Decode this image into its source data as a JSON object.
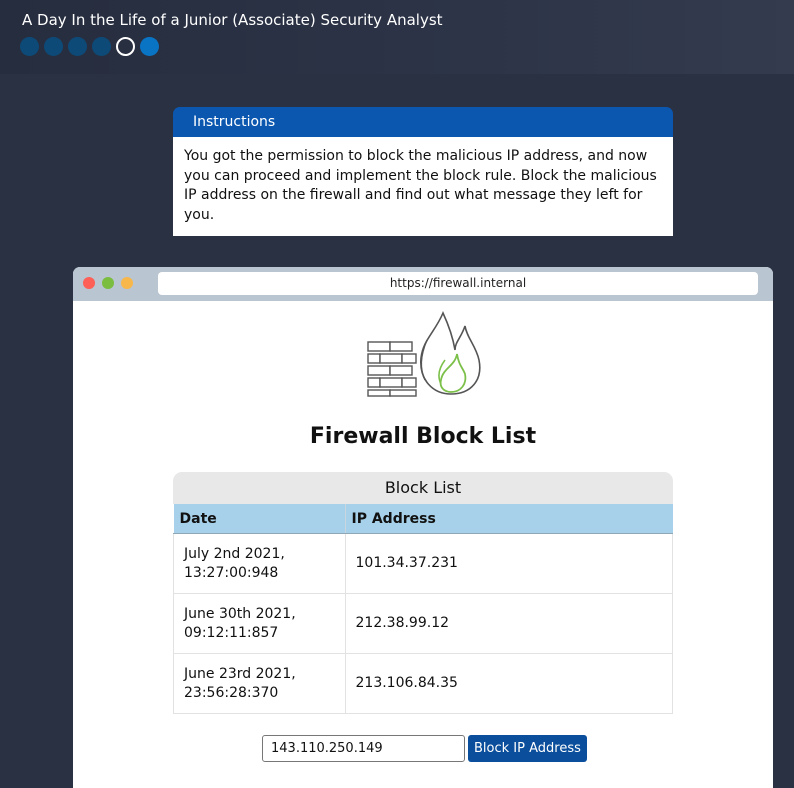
{
  "header": {
    "title": "A Day In the Life of a Junior (Associate) Security Analyst",
    "progress": {
      "total_steps": 6,
      "current_step": 5
    }
  },
  "instructions": {
    "title": "Instructions",
    "body": "You got the permission to block the malicious IP address, and now you can proceed and implement the block rule. Block the malicious IP address on the firewall and find out what message they left for you."
  },
  "browser": {
    "url": "https://firewall.internal"
  },
  "page": {
    "title": "Firewall Block List",
    "logo_icon": "firewall-flame-icon"
  },
  "block_list": {
    "caption": "Block List",
    "columns": [
      "Date",
      "IP Address"
    ],
    "rows": [
      {
        "date": "July 2nd 2021, 13:27:00:948",
        "ip": "101.34.37.231"
      },
      {
        "date": "June 30th 2021, 09:12:11:857",
        "ip": "212.38.99.12"
      },
      {
        "date": "June 23rd 2021, 23:56:28:370",
        "ip": "213.106.84.35"
      }
    ]
  },
  "form": {
    "ip_value": "143.110.250.149",
    "button_label": "Block IP Address"
  },
  "colors": {
    "background": "#2a3142",
    "instructions_header": "#0b57b0",
    "table_header": "#a7d1ea",
    "button": "#0b4f9c"
  }
}
